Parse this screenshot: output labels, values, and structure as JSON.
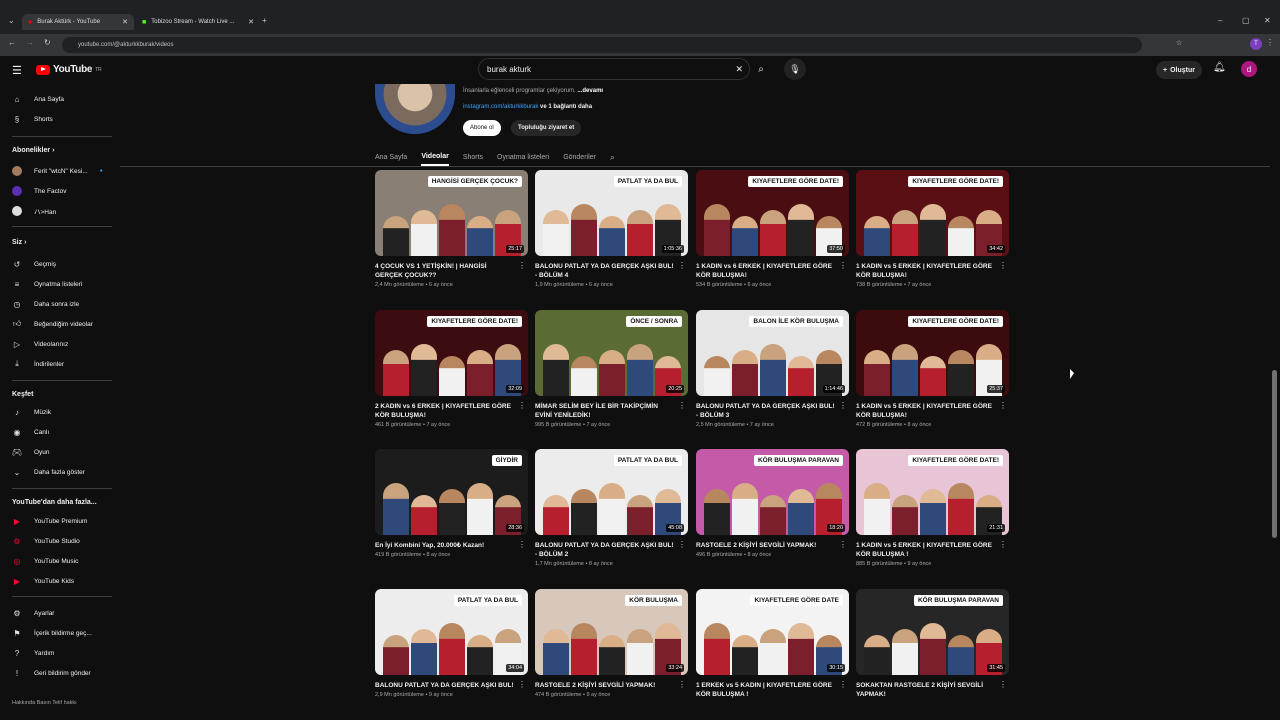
{
  "browser": {
    "tabs": [
      {
        "label": "Burak Aktürk - YouTube"
      },
      {
        "label": "Tobizoo Stream - Watch Live ..."
      }
    ],
    "url": "youtube.com/@akturkkburak/videos"
  },
  "header": {
    "logo": "YouTube",
    "logo_suffix": "TR",
    "search_value": "burak akturk",
    "create_label": "Oluştur",
    "avatar_letter": "d"
  },
  "sidebar": {
    "main": [
      {
        "label": "Ana Sayfa",
        "icon": "home-icon"
      },
      {
        "label": "Shorts",
        "icon": "shorts-icon"
      }
    ],
    "subs_title": "Abonelikler",
    "subs": [
      {
        "label": "Ferit \"wtcN\" Kesi..."
      },
      {
        "label": "The Factov"
      },
      {
        "label": "ハ>Han"
      }
    ],
    "you_title": "Siz",
    "you": [
      {
        "label": "Geçmiş",
        "icon": "history-icon"
      },
      {
        "label": "Oynatma listeleri",
        "icon": "playlist-icon"
      },
      {
        "label": "Daha sonra izle",
        "icon": "clock-icon"
      },
      {
        "label": "Beğendiğim videolar",
        "icon": "like-icon"
      },
      {
        "label": "Videolarınız",
        "icon": "video-icon"
      },
      {
        "label": "İndirilenler",
        "icon": "download-icon"
      }
    ],
    "explore_title": "Keşfet",
    "explore": [
      {
        "label": "Müzik",
        "icon": "music-icon"
      },
      {
        "label": "Canlı",
        "icon": "live-icon"
      },
      {
        "label": "Oyun",
        "icon": "gaming-icon"
      },
      {
        "label": "Daha fazla göster",
        "icon": "chevron-down-icon"
      }
    ],
    "more_title": "YouTube'dan daha fazla...",
    "more": [
      {
        "label": "YouTube Premium"
      },
      {
        "label": "YouTube Studio"
      },
      {
        "label": "YouTube Music"
      },
      {
        "label": "YouTube Kids"
      }
    ],
    "bottom": [
      {
        "label": "Ayarlar",
        "icon": "gear-icon"
      },
      {
        "label": "İçerik bildirme geç...",
        "icon": "flag-icon"
      },
      {
        "label": "Yardım",
        "icon": "help-icon"
      },
      {
        "label": "Geri bildirim gönder",
        "icon": "feedback-icon"
      }
    ],
    "footer": "Hakkında  Basın  Telif hakkı"
  },
  "channel": {
    "desc_text": "İnsanlarla eğlenceli programlar çekiyorum. ",
    "desc_more": "...devamı",
    "link": "instagram.com/akturkkburak",
    "link_more": " ve 1 bağlantı daha",
    "subscribe": "Abone ol",
    "community": "Topluluğu ziyaret et",
    "tabs": [
      "Ana Sayfa",
      "Videolar",
      "Shorts",
      "Oynatma listeleri",
      "Gönderiler"
    ]
  },
  "videos": [
    {
      "title": "4 ÇOCUK VS 1 YETİŞKİN! | HANGİSİ GERÇEK ÇOCUK??",
      "meta": "2,4 Mn görüntüleme • 6 ay önce",
      "dur": "25:17",
      "banner": "HANGİSİ GERÇEK ÇOCUK?",
      "bg": "#8a7f74"
    },
    {
      "title": "BALONU PATLAT YA DA GERÇEK AŞKI BUL! - BÖLÜM 4",
      "meta": "1,9 Mn görüntüleme • 6 ay önce",
      "dur": "1:05:36",
      "banner": "PATLAT YA DA BUL",
      "bg": "#e9e9e9"
    },
    {
      "title": "1 KADIN vs 6 ERKEK | KIYAFETLERE GÖRE KÖR BULUŞMA!",
      "meta": "534 B görüntüleme • 6 ay önce",
      "dur": "37:50",
      "banner": "KIYAFETLERE GÖRE DATE!",
      "bg": "#4a0d12"
    },
    {
      "title": "1 KADIN vs 5 ERKEK | KIYAFETLERE GÖRE KÖR BULUŞMA!",
      "meta": "738 B görüntüleme • 7 ay önce",
      "dur": "34:42",
      "banner": "KIYAFETLERE GÖRE DATE!",
      "bg": "#5a0f14"
    },
    {
      "title": "2 KADIN vs 6 ERKEK | KIYAFETLERE GÖRE KÖR BULUŞMA!",
      "meta": "461 B görüntüleme • 7 ay önce",
      "dur": "32:09",
      "banner": "KIYAFETLERE GÖRE DATE!",
      "bg": "#3d0c10"
    },
    {
      "title": "MİMAR SELİM BEY İLE BİR TAKİPÇİMİN EVİNİ YENİLEDİK!",
      "meta": "995 B görüntüleme • 7 ay önce",
      "dur": "20:25",
      "banner": "ÖNCE / SONRA",
      "bg": "#5b6b34"
    },
    {
      "title": "BALONU PATLAT YA DA GERÇEK AŞKI BUL! - BÖLÜM 3",
      "meta": "2,5 Mn görüntüleme • 7 ay önce",
      "dur": "1:14:46",
      "banner": "BALON İLE KÖR BULUŞMA",
      "bg": "#e6e6e6"
    },
    {
      "title": "1 KADIN vs 5 ERKEK | KIYAFETLERE GÖRE KÖR BULUŞMA!",
      "meta": "472 B görüntüleme • 8 ay önce",
      "dur": "25:37",
      "banner": "KIYAFETLERE GÖRE DATE!",
      "bg": "#3b0b0e"
    },
    {
      "title": "En İyi Kombini Yap, 20.000₺ Kazan!",
      "meta": "419 B görüntüleme • 8 ay önce",
      "dur": "28:36",
      "banner": "GİYDİR",
      "bg": "#1c1c1c"
    },
    {
      "title": "BALONU PATLAT YA DA GERÇEK AŞKI BUL! - BÖLÜM 2",
      "meta": "1,7 Mn görüntüleme • 8 ay önce",
      "dur": "45:08",
      "banner": "PATLAT YA DA BUL",
      "bg": "#ececec"
    },
    {
      "title": "RASTGELE 2 KİŞİYİ SEVGİLİ YAPMAK!",
      "meta": "496 B görüntüleme • 8 ay önce",
      "dur": "18:20",
      "banner": "KÖR BULUŞMA PARAVAN",
      "bg": "#c45aa8"
    },
    {
      "title": "1 KADIN vs 5 ERKEK | KIYAFETLERE GÖRE KÖR BULUŞMA !",
      "meta": "885 B görüntüleme • 9 ay önce",
      "dur": "21:31",
      "banner": "KIYAFETLERE GÖRE DATE!",
      "bg": "#e7c4d6"
    },
    {
      "title": "BALONU PATLAT YA DA GERÇEK AŞKI BUL!",
      "meta": "2,9 Mn görüntüleme • 9 ay önce",
      "dur": "34:04",
      "banner": "PATLAT YA DA BUL",
      "bg": "#ededed"
    },
    {
      "title": "RASTGELE 2 KİŞİYİ SEVGİLİ YAPMAK!",
      "meta": "474 B görüntüleme • 9 ay önce",
      "dur": "33:24",
      "banner": "KÖR BULUŞMA",
      "bg": "#d8c8bc"
    },
    {
      "title": "1 ERKEK vs 5 KADIN | KIYAFETLERE GÖRE KÖR BULUŞMA !",
      "meta": "",
      "dur": "30:15",
      "banner": "KIYAFETLERE GÖRE DATE",
      "bg": "#f3f3f3"
    },
    {
      "title": "SOKAKTAN RASTGELE 2 KİŞİYİ SEVGİLİ YAPMAK!",
      "meta": "",
      "dur": "31:45",
      "banner": "KÖR BULUŞMA PARAVAN",
      "bg": "#262626"
    }
  ],
  "colors": {
    "accent": "#ff0000",
    "bg": "#0f0f0f",
    "link": "#3ea6ff"
  }
}
